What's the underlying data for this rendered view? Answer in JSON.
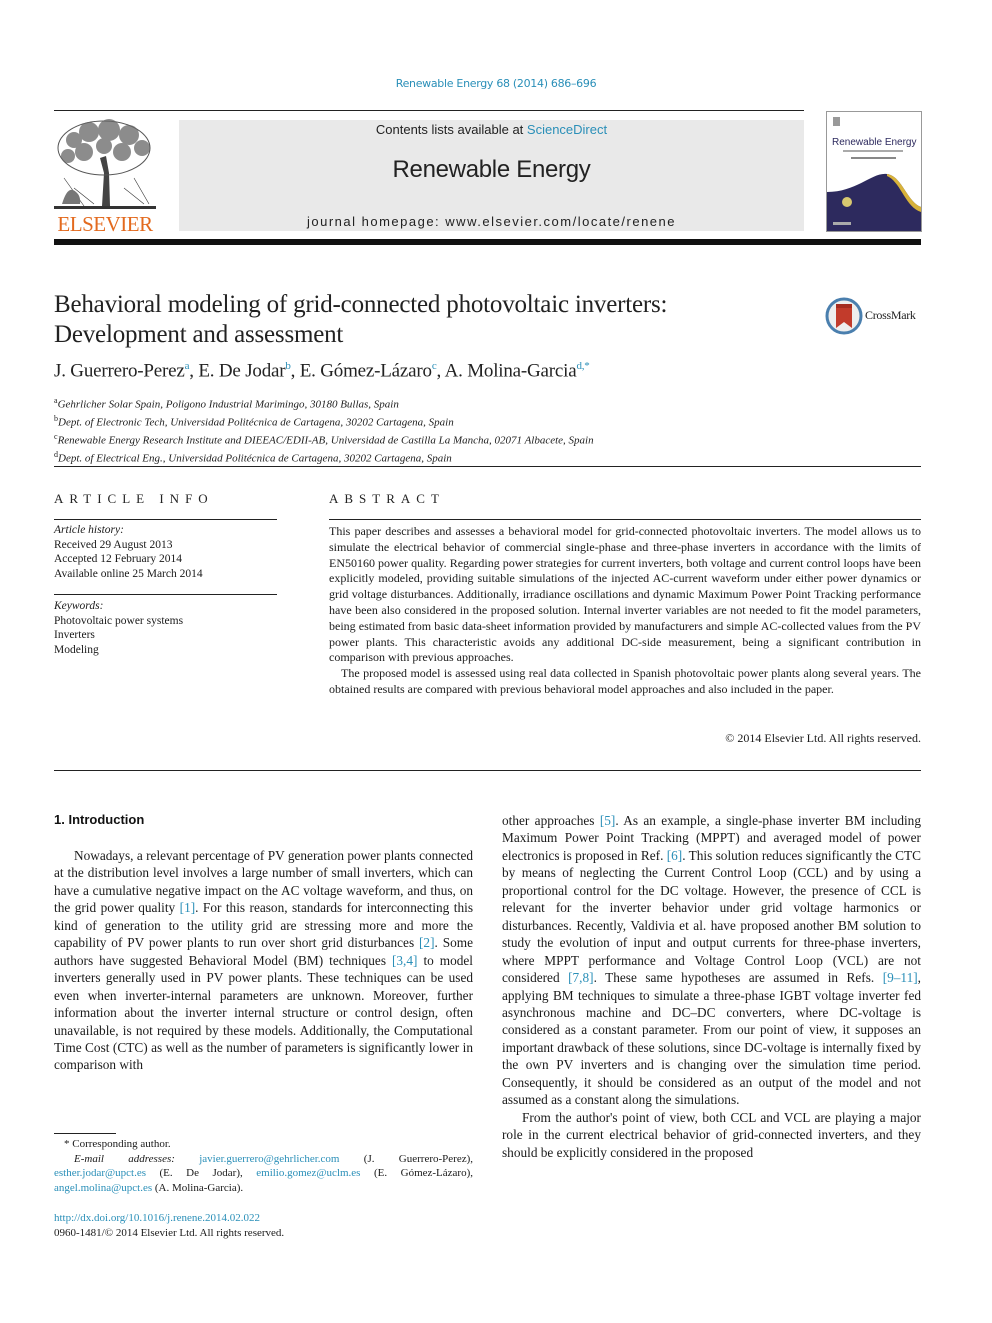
{
  "header": {
    "journal_ref": "Renewable Energy 68 (2014) 686–696",
    "contents_prefix": "Contents lists available at ",
    "contents_link": "ScienceDirect",
    "journal_title": "Renewable Energy",
    "homepage_prefix": "journal homepage: ",
    "homepage_url": "www.elsevier.com/locate/renene",
    "publisher_logo_text": "ELSEVIER",
    "cover_title": "Renewable Energy",
    "crossmark_label": "CrossMark"
  },
  "article": {
    "title": "Behavioral modeling of grid-connected photovoltaic inverters: Development and assessment",
    "authors": [
      {
        "name": "J. Guerrero-Perez",
        "sup": "a"
      },
      {
        "name": "E. De Jodar",
        "sup": "b"
      },
      {
        "name": "E. Gómez-Lázaro",
        "sup": "c"
      },
      {
        "name": "A. Molina-Garcia",
        "sup": "d,*"
      }
    ],
    "affiliations": [
      {
        "sup": "a",
        "text": "Gehrlicher Solar Spain, Poligono Industrial Marimingo, 30180 Bullas, Spain"
      },
      {
        "sup": "b",
        "text": "Dept. of Electronic Tech, Universidad Politécnica de Cartagena, 30202 Cartagena, Spain"
      },
      {
        "sup": "c",
        "text": "Renewable Energy Research Institute and DIEEAC/EDII-AB, Universidad de Castilla La Mancha, 02071 Albacete, Spain"
      },
      {
        "sup": "d",
        "text": "Dept. of Electrical Eng., Universidad Politécnica de Cartagena, 30202 Cartagena, Spain"
      }
    ]
  },
  "article_info": {
    "heading": "ARTICLE INFO",
    "history_label": "Article history:",
    "history": [
      "Received 29 August 2013",
      "Accepted 12 February 2014",
      "Available online 25 March 2014"
    ],
    "keywords_label": "Keywords:",
    "keywords": [
      "Photovoltaic power systems",
      "Inverters",
      "Modeling"
    ]
  },
  "abstract": {
    "heading": "ABSTRACT",
    "paragraphs": [
      "This paper describes and assesses a behavioral model for grid-connected photovoltaic inverters. The model allows us to simulate the electrical behavior of commercial single-phase and three-phase inverters in accordance with the limits of EN50160 power quality. Regarding power strategies for current inverters, both voltage and current control loops have been explicitly modeled, providing suitable simulations of the injected AC-current waveform under either power dynamics or grid voltage disturbances. Additionally, irradiance oscillations and dynamic Maximum Power Point Tracking performance have been also considered in the proposed solution. Internal inverter variables are not needed to fit the model parameters, being estimated from basic data-sheet information provided by manufacturers and simple AC-collected values from the PV power plants. This characteristic avoids any additional DC-side measurement, being a significant contribution in comparison with previous approaches.",
      "The proposed model is assessed using real data collected in Spanish photovoltaic power plants along several years. The obtained results are compared with previous behavioral model approaches and also included in the paper."
    ],
    "copyright": "© 2014 Elsevier Ltd. All rights reserved."
  },
  "body": {
    "section_heading": "1.  Introduction",
    "left_paragraph": [
      {
        "t": "Nowadays, a relevant percentage of PV generation power plants connected at the distribution level involves a large number of small inverters, which can have a cumulative negative impact on the AC voltage waveform, and thus, on the grid power quality "
      },
      {
        "ref": "[1]"
      },
      {
        "t": ". For this reason, standards for interconnecting this kind of generation to the utility grid are stressing more and more the capability of PV power plants to run over short grid disturbances "
      },
      {
        "ref": "[2]"
      },
      {
        "t": ". Some authors have suggested Behavioral Model (BM) techniques "
      },
      {
        "ref": "[3,4]"
      },
      {
        "t": " to model inverters generally used in PV power plants. These techniques can be used even when inverter-internal parameters are unknown. Moreover, further information about the inverter internal structure or control design, often unavailable, is not required by these models. Additionally, the Computational Time Cost (CTC) as well as the number of parameters is significantly lower in comparison with"
      }
    ],
    "right_paragraph_1": [
      {
        "t": "other approaches "
      },
      {
        "ref": "[5]"
      },
      {
        "t": ". As an example, a single-phase inverter BM including Maximum Power Point Tracking (MPPT) and averaged model of power electronics is proposed in Ref. "
      },
      {
        "ref": "[6]"
      },
      {
        "t": ". This solution reduces significantly the CTC by means of neglecting the Current Control Loop (CCL) and by using a proportional control for the DC voltage. However, the presence of CCL is relevant for the inverter behavior under grid voltage harmonics or disturbances. Recently, Valdivia et al. have proposed another BM solution to study the evolution of input and output currents for three-phase inverters, where MPPT performance and Voltage Control Loop (VCL) are not considered "
      },
      {
        "ref": "[7,8]"
      },
      {
        "t": ". These same hypotheses are assumed in Refs. "
      },
      {
        "ref": "[9–11]"
      },
      {
        "t": ", applying BM techniques to simulate a three-phase IGBT voltage inverter fed asynchronous machine and DC–DC converters, where DC-voltage is considered as a constant parameter. From our point of view, it supposes an important drawback of these solutions, since DC-voltage is internally fixed by the own PV inverters and is changing over the simulation time period. Consequently, it should be considered as an output of the model and not assumed as a constant along the simulations."
      }
    ],
    "right_paragraph_2": "From the author's point of view, both CCL and VCL are playing a major role in the current electrical behavior of grid-connected inverters, and they should be explicitly considered in the proposed"
  },
  "footnotes": {
    "corresponding": "* Corresponding author.",
    "email_label": "E-mail addresses:",
    "emails": [
      {
        "email": "javier.guerrero@gehrlicher.com",
        "name": " (J. Guerrero-Perez), "
      },
      {
        "email": "esther.jodar@upct.es",
        "name": " (E. De Jodar), "
      },
      {
        "email": "emilio.gomez@uclm.es",
        "name": " (E. Gómez-Lázaro), "
      },
      {
        "email": "angel.molina@upct.es",
        "name": " (A. Molina-Garcia)."
      }
    ],
    "doi": "http://dx.doi.org/10.1016/j.renene.2014.02.022",
    "issn": "0960-1481/© 2014 Elsevier Ltd. All rights reserved."
  },
  "colors": {
    "link": "#2a8fb8",
    "elsevier_orange": "#e36a1e",
    "header_box": "#e9e9e9",
    "cover_navy": "#2d2a5e",
    "cover_gold": "#d8b23a"
  }
}
